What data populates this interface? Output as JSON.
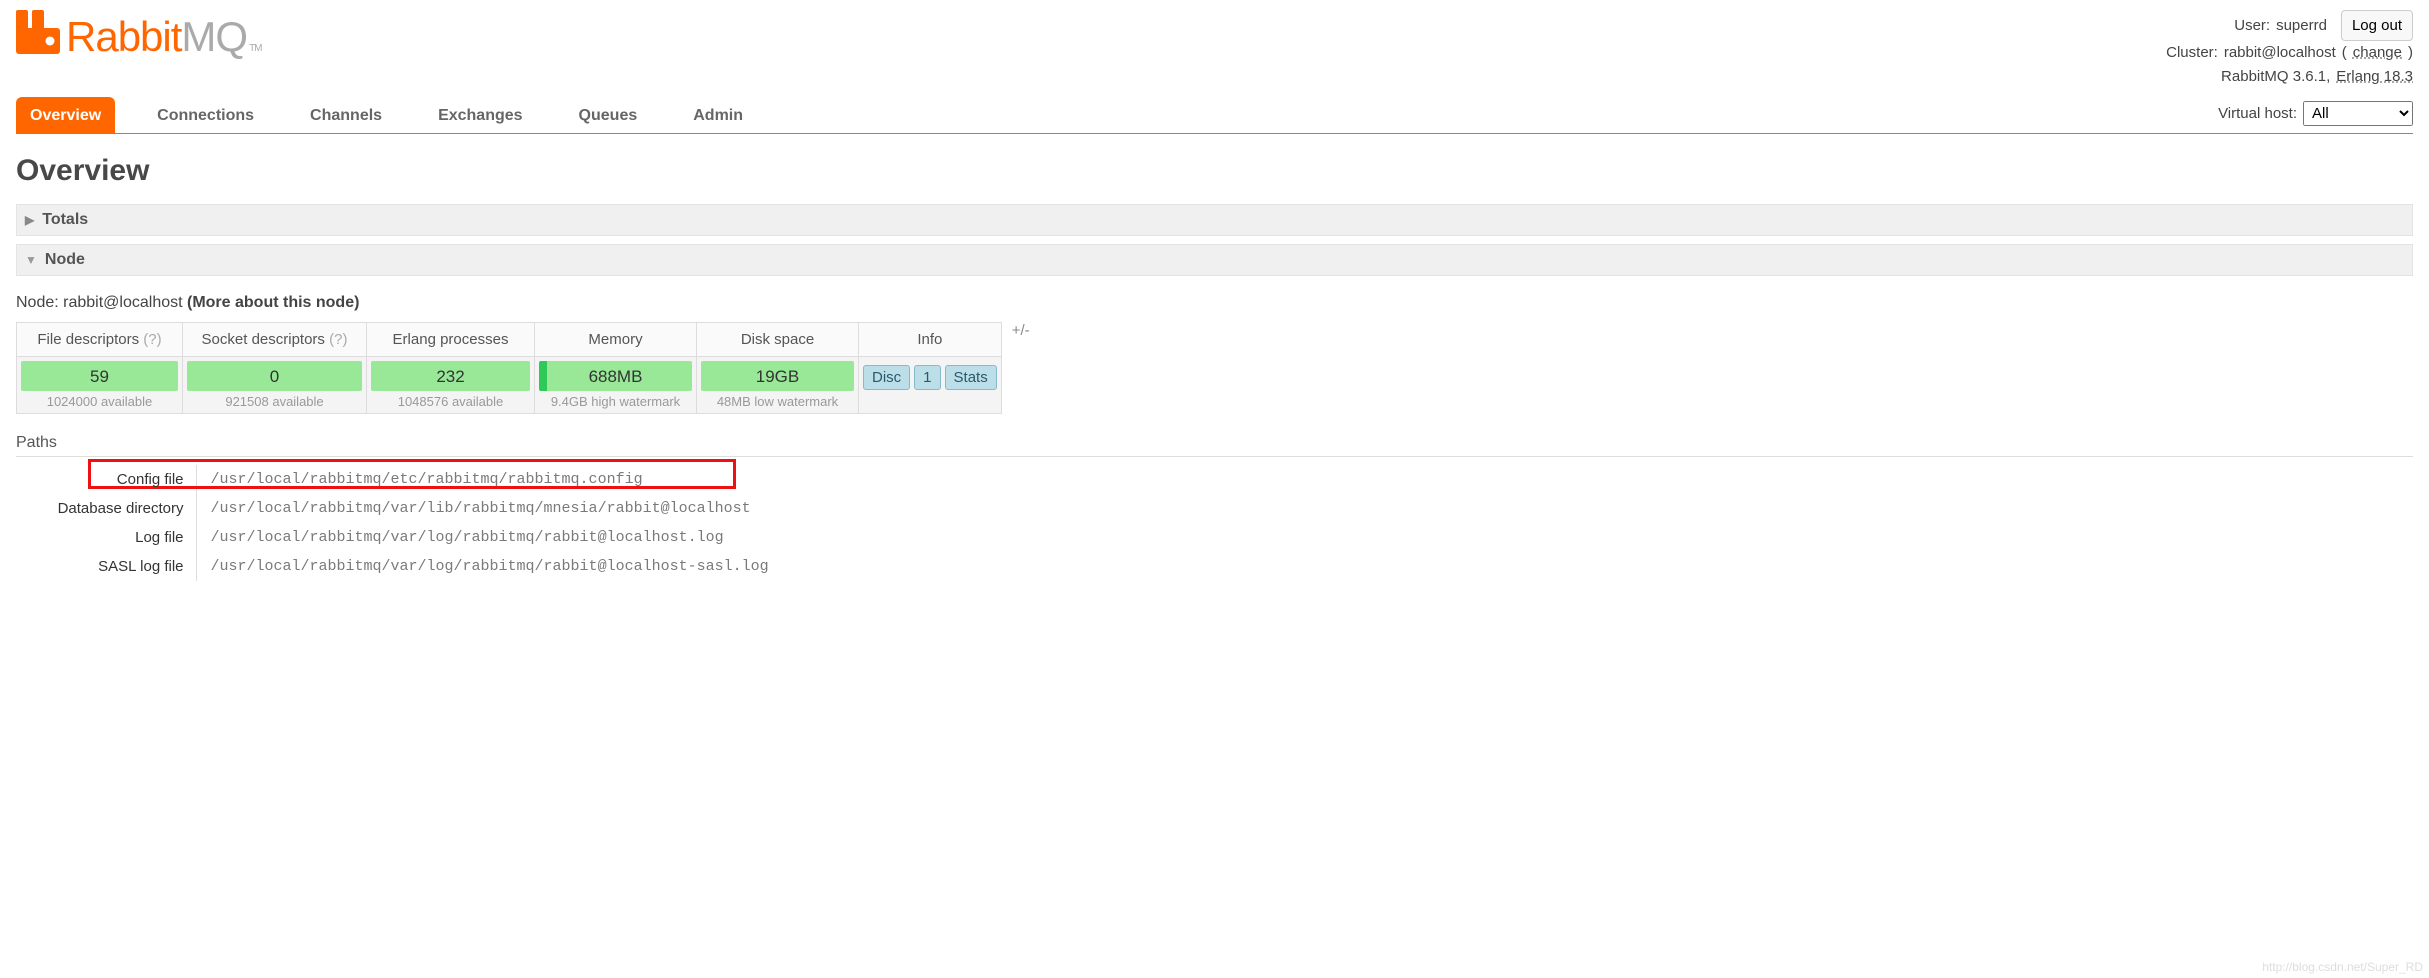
{
  "header": {
    "user_label": "User:",
    "user_value": "superrd",
    "cluster_label": "Cluster:",
    "cluster_value": "rabbit@localhost",
    "change_text": "change",
    "version_text": "RabbitMQ 3.6.1,",
    "erlang_text": "Erlang 18.3",
    "logout_label": "Log out"
  },
  "tabs": {
    "overview": "Overview",
    "connections": "Connections",
    "channels": "Channels",
    "exchanges": "Exchanges",
    "queues": "Queues",
    "admin": "Admin"
  },
  "vhost": {
    "label": "Virtual host:",
    "selected": "All"
  },
  "page_title": "Overview",
  "sections": {
    "totals": "Totals",
    "node": "Node"
  },
  "node_line": {
    "prefix": "Node: ",
    "name": "rabbit@localhost ",
    "more": "(More about this node)"
  },
  "stats": {
    "headers": {
      "fd": "File descriptors ",
      "sd": "Socket descriptors ",
      "ep": "Erlang processes",
      "mem": "Memory",
      "disk": "Disk space",
      "info": "Info",
      "q": "(?)"
    },
    "fd": {
      "value": "59",
      "sub": "1024000 available"
    },
    "sd": {
      "value": "0",
      "sub": "921508 available"
    },
    "ep": {
      "value": "232",
      "sub": "1048576 available"
    },
    "mem": {
      "value": "688MB",
      "sub": "9.4GB high watermark"
    },
    "disk": {
      "value": "19GB",
      "sub": "48MB low watermark"
    },
    "info": {
      "b1": "Disc",
      "b2": "1",
      "b3": "Stats"
    },
    "plusminus": "+/-"
  },
  "paths": {
    "heading": "Paths",
    "rows": [
      {
        "k": "Config file",
        "v": "/usr/local/rabbitmq/etc/rabbitmq/rabbitmq.config"
      },
      {
        "k": "Database directory",
        "v": "/usr/local/rabbitmq/var/lib/rabbitmq/mnesia/rabbit@localhost"
      },
      {
        "k": "Log file",
        "v": "/usr/local/rabbitmq/var/log/rabbitmq/rabbit@localhost.log"
      },
      {
        "k": "SASL log file",
        "v": "/usr/local/rabbitmq/var/log/rabbitmq/rabbit@localhost-sasl.log"
      }
    ]
  },
  "watermark": "http://blog.csdn.net/Super_RD"
}
